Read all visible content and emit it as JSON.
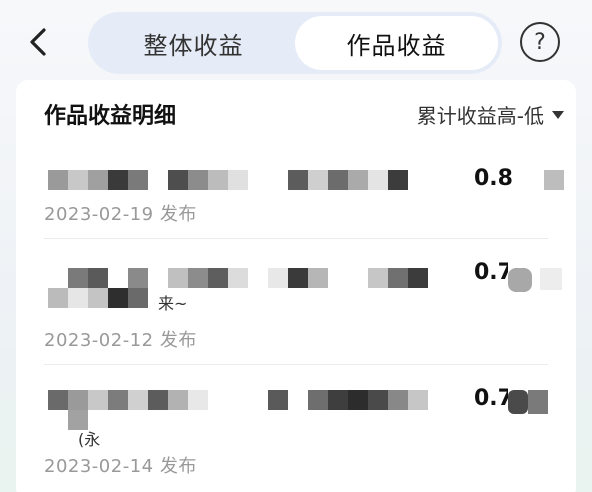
{
  "header": {
    "tabs": [
      {
        "label": "整体收益",
        "active": false
      },
      {
        "label": "作品收益",
        "active": true
      }
    ],
    "help_icon": "question-circle-icon",
    "back_icon": "chevron-left-icon"
  },
  "card": {
    "title": "作品收益明细",
    "sort_label": "累计收益高-低",
    "items": [
      {
        "amount": "0.82",
        "date": "2023-02-19 发布"
      },
      {
        "amount": "0.7",
        "date": "2023-02-12 发布",
        "fragment": "来~"
      },
      {
        "amount": "0.7",
        "date": "2023-02-14 发布",
        "fragment": "(永"
      }
    ]
  },
  "colors": {
    "segment_bg": "#e6ecf7",
    "active_tab_bg": "#ffffff",
    "date_text": "#999999"
  }
}
